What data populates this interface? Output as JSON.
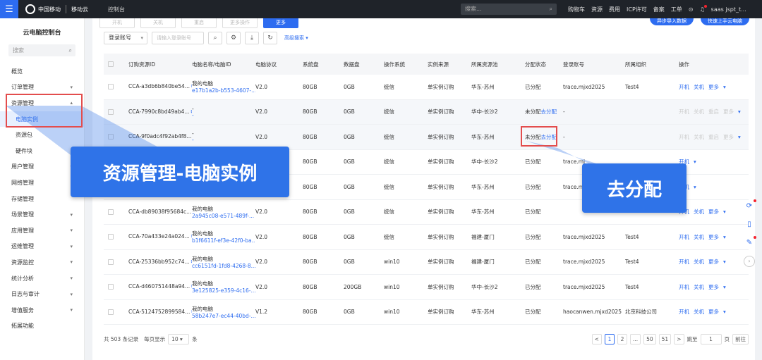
{
  "topbar": {
    "brand_left": "中国移动",
    "brand_left_sub": "China Mobile",
    "brand_right": "移动云",
    "console": "控制台",
    "search_placeholder": "搜索...",
    "nav": [
      "购物车",
      "资源",
      "费用",
      "ICP许可",
      "备案",
      "工单",
      "?",
      "Ω"
    ],
    "user": "saas jspt_t..."
  },
  "sidebar": {
    "title": "云电脑控制台",
    "search_placeholder": "搜索",
    "items": [
      {
        "label": "概览"
      },
      {
        "label": "订单管理"
      },
      {
        "label": "资源管理"
      },
      {
        "label": "电脑实例"
      },
      {
        "label": "资源包"
      },
      {
        "label": "硬件块"
      },
      {
        "label": "用户管理"
      },
      {
        "label": "网络管理"
      },
      {
        "label": "存储管理"
      },
      {
        "label": "场景管理"
      },
      {
        "label": "应用管理"
      },
      {
        "label": "运维管理"
      },
      {
        "label": "资源监控"
      },
      {
        "label": "统计分析"
      },
      {
        "label": "日志与审计"
      },
      {
        "label": "增值服务"
      },
      {
        "label": "拓展功能"
      }
    ]
  },
  "toolbar": {
    "top_buttons": [
      "开机",
      "关机",
      "重启",
      "更多",
      "更多操作"
    ],
    "top_right": [
      "异步导入数据",
      "快速上手云电脑"
    ],
    "filter_select": "登录账号",
    "filter_input_placeholder": "请输入登录账号",
    "advanced_search": "高级搜索"
  },
  "table": {
    "headers": [
      "订购资源ID",
      "电脑名称/电脑ID",
      "电脑协议",
      "系统盘",
      "数据盘",
      "操作系统",
      "实例来源",
      "所属资源池",
      "分配状态",
      "登录账号",
      "所属组织",
      "操作"
    ],
    "rows": [
      {
        "id": "CCA-a3db6b840be54...",
        "name1": "我的电脑",
        "name2": "e17b1a2b-b553-4607-...",
        "proto": "V2.0",
        "sys": "80GB",
        "data": "0GB",
        "os": "统信",
        "src": "单实例订购",
        "pool": "华东-苏州",
        "status": "已分配",
        "status_link": "",
        "acct": "trace.mjxd2025",
        "org": "Test4",
        "ops": [
          "开机",
          "关机",
          "更多"
        ]
      },
      {
        "id": "CCA-7990c8bd49ab4...",
        "name1": "-",
        "name2": "-",
        "proto": "V2.0",
        "sys": "80GB",
        "data": "0GB",
        "os": "统信",
        "src": "单实例订购",
        "pool": "华中-长沙2",
        "status": "未分配",
        "status_link": "去分配",
        "acct": "-",
        "org": "",
        "ops": [
          "开机",
          "关机",
          "重启",
          "更多"
        ]
      },
      {
        "id": "CCA-9f0adc4f92ab4f8...",
        "name1": "-",
        "name2": "-",
        "proto": "V2.0",
        "sys": "80GB",
        "data": "0GB",
        "os": "统信",
        "src": "单实例订购",
        "pool": "华东-苏州",
        "status": "未分配",
        "status_link": "去分配",
        "acct": "-",
        "org": "",
        "ops": [
          "开机",
          "关机",
          "重启",
          "更多"
        ]
      },
      {
        "id": "",
        "name1": "",
        "name2": "",
        "proto": "",
        "sys": "80GB",
        "data": "0GB",
        "os": "统信",
        "src": "单实例订购",
        "pool": "华中-长沙2",
        "status": "已分配",
        "status_link": "",
        "acct": "trace.mj",
        "org": "",
        "ops": [
          "开机"
        ]
      },
      {
        "id": "",
        "name1": "",
        "name2": "",
        "proto": "",
        "sys": "80GB",
        "data": "0GB",
        "os": "统信",
        "src": "单实例订购",
        "pool": "华东-苏州",
        "status": "已分配",
        "status_link": "",
        "acct": "trace.m",
        "org": "",
        "ops": [
          "开机"
        ]
      },
      {
        "id": "CCA-db89038f95684c...",
        "name1": "我的电脑",
        "name2": "2a945c08-e571-489f-...",
        "proto": "V2.0",
        "sys": "80GB",
        "data": "0GB",
        "os": "统信",
        "src": "单实例订购",
        "pool": "华东-苏州",
        "status": "已分配",
        "status_link": "",
        "acct": "",
        "org": "",
        "ops": [
          "开机",
          "关机",
          "更多"
        ]
      },
      {
        "id": "CCA-70a433e24a024...",
        "name1": "我的电脑",
        "name2": "b1f6611f-ef3e-42f0-ba...",
        "proto": "V2.0",
        "sys": "80GB",
        "data": "0GB",
        "os": "统信",
        "src": "单实例订购",
        "pool": "福建-厦门",
        "status": "已分配",
        "status_link": "",
        "acct": "trace.mjxd2025",
        "org": "Test4",
        "ops": [
          "开机",
          "关机",
          "更多"
        ]
      },
      {
        "id": "CCA-25336bb952c74...",
        "name1": "我的电脑",
        "name2": "cc6151fd-1fd8-4268-8...",
        "proto": "V2.0",
        "sys": "80GB",
        "data": "0GB",
        "os": "win10",
        "src": "单实例订购",
        "pool": "福建-厦门",
        "status": "已分配",
        "status_link": "",
        "acct": "trace.mjxd2025",
        "org": "Test4",
        "ops": [
          "开机",
          "关机",
          "更多"
        ]
      },
      {
        "id": "CCA-d460751448a94...",
        "name1": "我的电脑",
        "name2": "3e125825-e359-4c16-...",
        "proto": "V2.0",
        "sys": "80GB",
        "data": "200GB",
        "os": "win10",
        "src": "单实例订购",
        "pool": "华中-长沙2",
        "status": "已分配",
        "status_link": "",
        "acct": "trace.mjxd2025",
        "org": "Test4",
        "ops": [
          "开机",
          "关机",
          "更多"
        ]
      },
      {
        "id": "CCA-5124752899584...",
        "name1": "我的电脑",
        "name2": "58b247e7-ec44-40bd-...",
        "proto": "V1.2",
        "sys": "80GB",
        "data": "0GB",
        "os": "win10",
        "src": "单实例订购",
        "pool": "华东-苏州",
        "status": "已分配",
        "status_link": "",
        "acct": "haocanwen.mjxd2025",
        "org": "北京科技公司",
        "ops": [
          "开机",
          "关机",
          "更多"
        ]
      }
    ]
  },
  "pager": {
    "total": "共 503 条记录",
    "per_page_label": "每页显示",
    "per_page": "10",
    "unit": "条",
    "pages": [
      "<",
      "1",
      "2",
      "...",
      "50",
      "51",
      ">"
    ],
    "goto_label": "跳至",
    "goto_value": "1",
    "goto_unit": "页",
    "goto_btn": "前往"
  },
  "annotations": {
    "callout_left": "资源管理-电脑实例",
    "callout_right": "去分配"
  }
}
